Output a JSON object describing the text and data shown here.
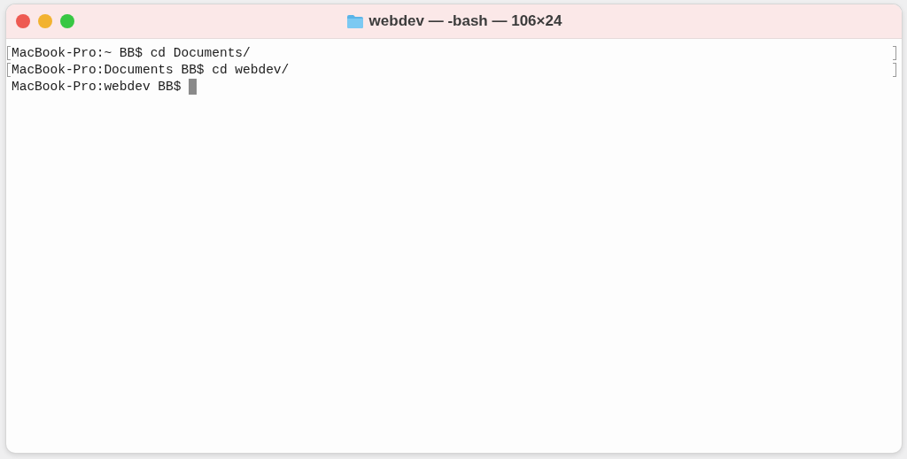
{
  "window": {
    "title": "webdev — -bash — 106×24"
  },
  "lines": [
    {
      "text": "MacBook-Pro:~ BB$ cd Documents/",
      "marked": true,
      "cursor": false
    },
    {
      "text": "MacBook-Pro:Documents BB$ cd webdev/",
      "marked": true,
      "cursor": false
    },
    {
      "text": "MacBook-Pro:webdev BB$ ",
      "marked": false,
      "cursor": true
    }
  ]
}
